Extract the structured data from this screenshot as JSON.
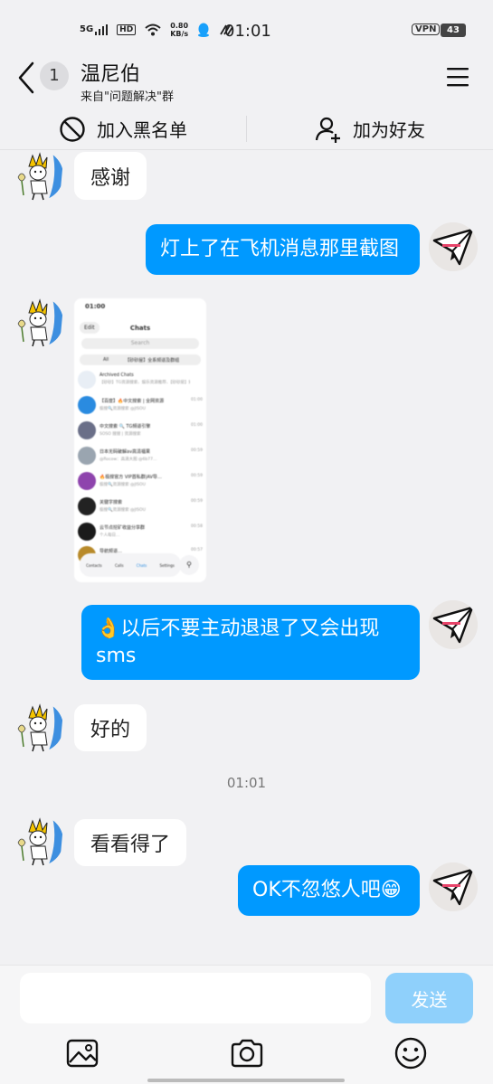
{
  "status_bar": {
    "network": "5G",
    "hd": "HD",
    "speed_value": "0.80",
    "speed_unit": "KB/s",
    "time": "01:01",
    "vpn": "VPN",
    "battery": "43"
  },
  "header": {
    "unread_count": "1",
    "title": "温尼伯",
    "subtitle": "来自\"问题解决\"群"
  },
  "actions": {
    "blacklist_label": "加入黑名单",
    "add_friend_label": "加为好友"
  },
  "messages": [
    {
      "side": "left",
      "text": "感谢"
    },
    {
      "side": "right",
      "text": "灯上了在飞机消息那里截图"
    },
    {
      "side": "left",
      "type": "image"
    },
    {
      "side": "right",
      "text_line1": "👌以后不要主动退退了又会出现",
      "text_line2": "sms"
    },
    {
      "side": "left",
      "text": "好的"
    },
    {
      "type": "time",
      "text": "01:01"
    },
    {
      "side": "left",
      "text": "看看得了"
    },
    {
      "side": "right",
      "text": "OK不忽悠人吧😁"
    }
  ],
  "screenshot": {
    "time": "01:00",
    "edit": "Edit",
    "title": "Chats",
    "search": "Search",
    "tab_all": "All",
    "tab_other": "【砂砂屋】全系频道及群组",
    "rows": [
      {
        "l1": "Archived Chats",
        "l2": "【砂砂】TG资源搜索、娱乐资源推荐、【砂砂屋】娱乐看片-砂砂资源搜索群、砂砂看片",
        "time": "",
        "color": "#e8eef5"
      },
      {
        "l1": "【百度】🔥中文搜索 | 全网资源",
        "l2": "极搜🔍资源搜索 @JISOU",
        "time": "01:00",
        "color": "#2a8be0"
      },
      {
        "l1": "中文搜索 🔍 TG頻道引擎",
        "l2": "SOSO 搜搜 | 资源搜索",
        "time": "01:00",
        "color": "#6a6f88"
      },
      {
        "l1": "日本无码破解av高清福果",
        "l2": "@Rocow：高清大图 @6b77…",
        "time": "00:59",
        "color": "#9aa5b0"
      },
      {
        "l1": "🔥极搜官方 VIP首私群|AV导…",
        "l2": "极搜🔍资源搜索 @JISOU",
        "time": "00:59",
        "color": "#8e44ad"
      },
      {
        "l1": "关键字搜索",
        "l2": "极搜🔍资源搜索 @JISOU",
        "time": "00:59",
        "color": "#222222"
      },
      {
        "l1": "云节点挖矿收益分享群",
        "l2": "个人每日…",
        "time": "00:58",
        "color": "#1a1a1a"
      },
      {
        "l1": "导航频道…",
        "l2": "",
        "time": "00:57",
        "color": "#b88a2a"
      }
    ],
    "nav_contacts": "Contacts",
    "nav_calls": "Calls",
    "nav_chats": "Chats",
    "nav_settings": "Settings"
  },
  "input": {
    "value": "",
    "send_label": "发送"
  },
  "colors": {
    "accent": "#0099ff",
    "send_disabled": "#8fd0fb",
    "background": "#f1f1f3"
  },
  "icons": {
    "back": "chevron-left-icon",
    "menu": "hamburger-menu-icon",
    "blacklist": "block-icon",
    "add_friend": "add-person-icon",
    "image": "image-icon",
    "camera": "camera-icon",
    "emoji": "emoji-icon"
  }
}
